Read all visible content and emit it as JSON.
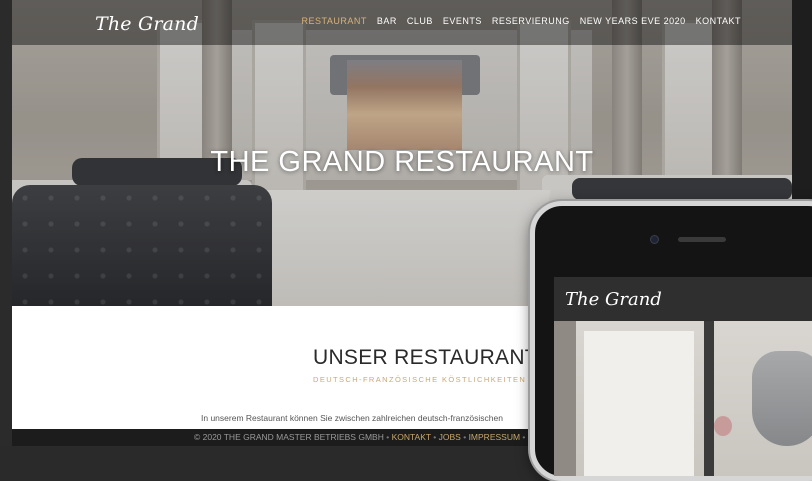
{
  "site": {
    "logo": "The Grand",
    "nav": [
      {
        "label": "RESTAURANT",
        "active": true
      },
      {
        "label": "BAR",
        "active": false
      },
      {
        "label": "CLUB",
        "active": false
      },
      {
        "label": "EVENTS",
        "active": false
      },
      {
        "label": "RESERVIERUNG",
        "active": false
      },
      {
        "label": "NEW YEARS EVE 2020",
        "active": false
      },
      {
        "label": "KONTAKT",
        "active": false
      }
    ],
    "hero_title": "THE GRAND RESTAURANT",
    "section": {
      "title": "UNSER RESTAURANT",
      "subtitle": "DEUTSCH-FRANZÖSISCHE KÖSTLICHKEITEN",
      "text": "In unserem Restaurant können Sie zwischen zahlreichen deutsch-französischen"
    },
    "footer": {
      "copyright": "© 2020 THE GRAND MASTER BETRIEBS GMBH",
      "links": [
        "KONTAKT",
        "JOBS",
        "IMPRESSUM"
      ]
    }
  },
  "phone": {
    "logo": "The Grand"
  },
  "colors": {
    "accent": "#d7b27a",
    "nav_bg": "rgba(0,0,0,0.42)",
    "footer_bg": "#1c1c1c"
  }
}
